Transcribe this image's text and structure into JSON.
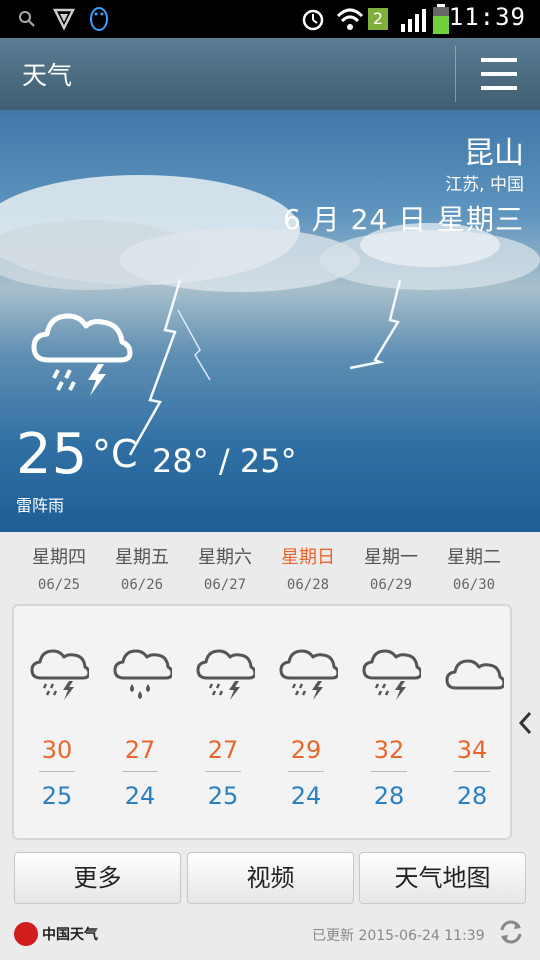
{
  "status": {
    "time": "11:39",
    "sim_badge": "2"
  },
  "header": {
    "title": "天气"
  },
  "current": {
    "city": "昆山",
    "region": "江苏, 中国",
    "date": "6 月 24 日 星期三",
    "temp": "25",
    "unit": "°C",
    "range": "28° / 25°",
    "condition": "雷阵雨",
    "icon": "thunderstorm-icon"
  },
  "forecast": [
    {
      "day": "星期四",
      "date": "06/25",
      "icon": "thunderstorm-icon",
      "high": "30",
      "low": "25"
    },
    {
      "day": "星期五",
      "date": "06/26",
      "icon": "rain-icon",
      "high": "27",
      "low": "24"
    },
    {
      "day": "星期六",
      "date": "06/27",
      "icon": "thunderstorm-icon",
      "high": "27",
      "low": "25"
    },
    {
      "day": "星期日",
      "date": "06/28",
      "icon": "thunderstorm-icon",
      "high": "29",
      "low": "24"
    },
    {
      "day": "星期一",
      "date": "06/29",
      "icon": "thunderstorm-icon",
      "high": "32",
      "low": "28"
    },
    {
      "day": "星期二",
      "date": "06/30",
      "icon": "cloudy-icon",
      "high": "34",
      "low": "28"
    }
  ],
  "buttons": {
    "more": "更多",
    "video": "视频",
    "map": "天气地图"
  },
  "footer": {
    "brand": "中国天气",
    "updated": "已更新 2015-06-24 11:39"
  },
  "colors": {
    "high": "#e8672f",
    "low": "#2a7fc1",
    "highlight_day": "#e8672f"
  }
}
